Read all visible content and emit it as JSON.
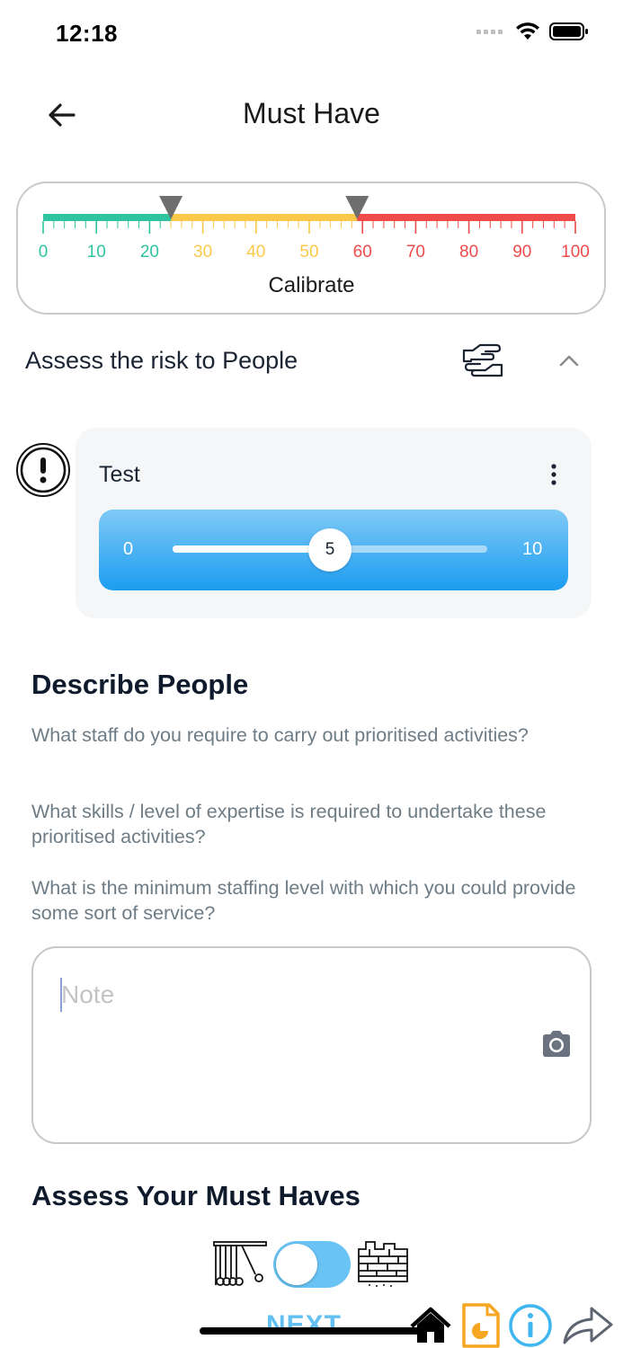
{
  "status_bar": {
    "time": "12:18"
  },
  "header": {
    "title": "Must Have",
    "back_icon": "arrow-left-icon"
  },
  "calibrate": {
    "label": "Calibrate",
    "ticks": [
      "0",
      "10",
      "20",
      "30",
      "40",
      "50",
      "60",
      "70",
      "80",
      "90",
      "100"
    ],
    "markers": [
      24,
      59
    ],
    "colors": {
      "green": "#2ec4a0",
      "yellow": "#fbc94a",
      "red": "#ef4b4b"
    }
  },
  "risk_section": {
    "title": "Assess the risk to People",
    "icon": "hands-icon",
    "chevron": "chevron-up-icon"
  },
  "test_card": {
    "title": "Test",
    "slider": {
      "min_label": "0",
      "max_label": "10",
      "value": 5,
      "min": 0,
      "max": 10
    }
  },
  "describe": {
    "title": "Describe People",
    "questions": [
      "What staff do you require to carry out prioritised activities?",
      "What skills / level of expertise is required to undertake these prioritised activities?",
      "What is the minimum staffing level with which you could provide some sort of service?"
    ],
    "note_placeholder": "Note"
  },
  "must_haves": {
    "title": "Assess Your Must Haves",
    "toggle_on": true
  },
  "bottom_bar": {
    "next_label": "NEXT"
  }
}
